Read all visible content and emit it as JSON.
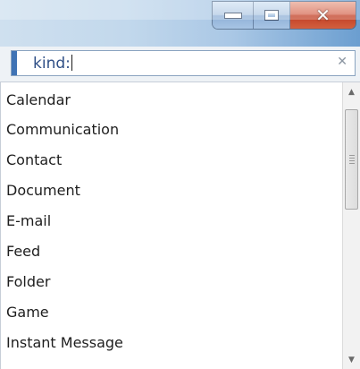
{
  "window": {
    "buttons": {
      "minimize_icon": "minimize-icon",
      "maximize_icon": "maximize-icon",
      "close_icon": "close-icon",
      "close_glyph": "✕",
      "close_color": "#c13f25"
    }
  },
  "search": {
    "value": "kind:",
    "clear_glyph": "✕",
    "accent_color": "#3f73b5"
  },
  "list": {
    "items": [
      "Calendar",
      "Communication",
      "Contact",
      "Document",
      "E-mail",
      "Feed",
      "Folder",
      "Game",
      "Instant Message"
    ]
  },
  "scrollbar": {
    "up_glyph": "▲",
    "down_glyph": "▼"
  }
}
